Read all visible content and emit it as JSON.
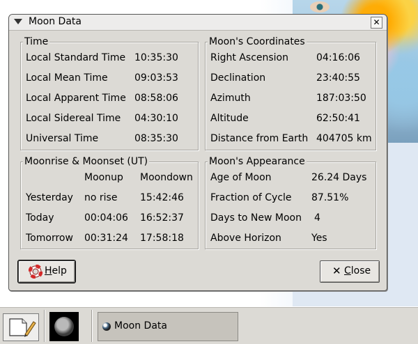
{
  "window": {
    "title": "Moon Data"
  },
  "time": {
    "legend": "Time",
    "rows": [
      {
        "label": "Local Standard Time",
        "value": "10:35:30"
      },
      {
        "label": "Local Mean Time",
        "value": "09:03:53"
      },
      {
        "label": "Local Apparent Time",
        "value": "08:58:06"
      },
      {
        "label": "Local Sidereal Time",
        "value": "04:30:10"
      },
      {
        "label": "Universal Time",
        "value": "08:35:30"
      }
    ]
  },
  "coords": {
    "legend": "Moon's Coordinates",
    "rows": [
      {
        "label": "Right Ascension",
        "value": "04:16:06"
      },
      {
        "label": "Declination",
        "value": "23:40:55"
      },
      {
        "label": "Azimuth",
        "value": "187:03:50"
      },
      {
        "label": "Altitude",
        "value": "62:50:41"
      },
      {
        "label": "Distance from Earth",
        "value": "404705 km"
      }
    ]
  },
  "rise": {
    "legend": "Moonrise & Moonset (UT)",
    "col_up": "Moonup",
    "col_down": "Moondown",
    "rows": [
      {
        "day": "Yesterday",
        "up": "no rise",
        "down": "15:42:46"
      },
      {
        "day": "Today",
        "up": "00:04:06",
        "down": "16:52:37"
      },
      {
        "day": "Tomorrow",
        "up": "00:31:24",
        "down": "17:58:18"
      }
    ]
  },
  "appearance": {
    "legend": "Moon's Appearance",
    "rows": [
      {
        "label": "Age of Moon",
        "value": "26.24 Days"
      },
      {
        "label": "Fraction of Cycle",
        "value": "87.51%"
      },
      {
        "label": "Days to New Moon",
        "value": "4"
      },
      {
        "label": "Above Horizon",
        "value": "Yes"
      }
    ]
  },
  "buttons": {
    "help_rest": "elp",
    "help_mnemonic": "H",
    "close_rest": "lose",
    "close_mnemonic": "C"
  },
  "taskbar": {
    "task_label": "Moon Data"
  },
  "icons": {
    "window_menu": "triangle-down-icon",
    "window_close": "close-icon",
    "help": "lifebuoy-icon",
    "close": "x-icon",
    "launcher": "notepad-pencil-icon",
    "moon": "moon-phase-icon"
  }
}
